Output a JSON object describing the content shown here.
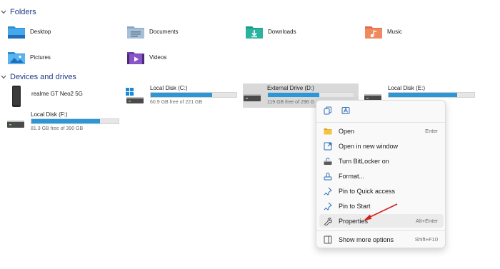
{
  "sections": {
    "folders": "Folders",
    "devices": "Devices and drives"
  },
  "folders": [
    {
      "name": "Desktop",
      "icon": "desktop-folder-icon"
    },
    {
      "name": "Documents",
      "icon": "documents-folder-icon"
    },
    {
      "name": "Downloads",
      "icon": "downloads-folder-icon"
    },
    {
      "name": "Music",
      "icon": "music-folder-icon"
    },
    {
      "name": "Pictures",
      "icon": "pictures-folder-icon"
    },
    {
      "name": "Videos",
      "icon": "videos-folder-icon"
    }
  ],
  "drives": [
    {
      "name": "realme GT Neo2 5G",
      "free": "",
      "used_fraction": null,
      "icon": "phone-icon"
    },
    {
      "name": "Local Disk (C:)",
      "free": "60.9 GB free of 221 GB",
      "used_fraction": 0.72,
      "icon": "windows-drive-icon"
    },
    {
      "name": "External Drive (D:)",
      "free": "119 GB free of 296 G",
      "used_fraction": 0.6,
      "icon": "drive-icon"
    },
    {
      "name": "Local Disk (E:)",
      "free": "",
      "used_fraction": 0.8,
      "icon": "drive-icon"
    },
    {
      "name": "Local Disk (F:)",
      "free": "81.3 GB free of 390 GB",
      "used_fraction": 0.79,
      "icon": "drive-icon"
    }
  ],
  "context_menu": {
    "quick_actions": [
      "copy-icon",
      "rename-icon"
    ],
    "items": [
      {
        "label": "Open",
        "shortcut": "Enter",
        "icon": "open-folder-icon"
      },
      {
        "label": "Open in new window",
        "shortcut": "",
        "icon": "new-window-icon"
      },
      {
        "label": "Turn BitLocker on",
        "shortcut": "",
        "icon": "bitlocker-icon"
      },
      {
        "label": "Format...",
        "shortcut": "",
        "icon": "format-icon"
      },
      {
        "label": "Pin to Quick access",
        "shortcut": "",
        "icon": "pin-icon"
      },
      {
        "label": "Pin to Start",
        "shortcut": "",
        "icon": "pin-icon"
      },
      {
        "label": "Properties",
        "shortcut": "Alt+Enter",
        "icon": "wrench-icon"
      },
      {
        "label": "Show more options",
        "shortcut": "Shift+F10",
        "icon": "more-options-icon"
      }
    ]
  },
  "colors": {
    "accent": "#2b96d8",
    "header_text": "#1f3a8a",
    "arrow": "#d42020"
  }
}
